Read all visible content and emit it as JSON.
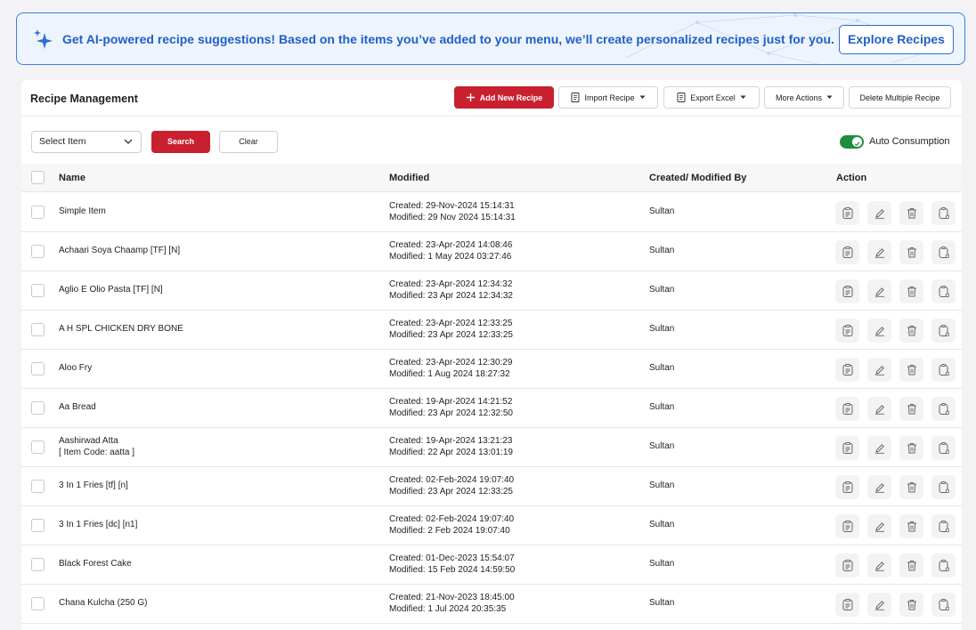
{
  "banner": {
    "text": "Get AI-powered recipe suggestions! Based on the items you’ve added to your menu, we’ll create personalized recipes just for you.",
    "button": "Explore Recipes"
  },
  "header": {
    "title": "Recipe Management",
    "add": "Add New Recipe",
    "import": "Import Recipe",
    "export": "Export Excel",
    "more": "More Actions",
    "delete_multiple": "Delete Multiple Recipe"
  },
  "filters": {
    "select_value": "Select Item",
    "search": "Search",
    "clear": "Clear",
    "auto_consumption": "Auto Consumption"
  },
  "table": {
    "columns": {
      "name": "Name",
      "modified": "Modified",
      "by": "Created/ Modified By",
      "action": "Action"
    },
    "rows": [
      {
        "name": "Simple Item",
        "sub": "",
        "created": "Created: 29-Nov-2024 15:14:31",
        "modified": "Modified: 29 Nov 2024 15:14:31",
        "by": "Sultan"
      },
      {
        "name": "Achaari Soya Chaamp [TF] [N]",
        "sub": "",
        "created": "Created: 23-Apr-2024 14:08:46",
        "modified": "Modified: 1 May 2024 03:27:46",
        "by": "Sultan"
      },
      {
        "name": "Aglio E Olio Pasta [TF] [N]",
        "sub": "",
        "created": "Created: 23-Apr-2024 12:34:32",
        "modified": "Modified: 23 Apr 2024 12:34:32",
        "by": "Sultan"
      },
      {
        "name": "A H SPL CHICKEN DRY BONE",
        "sub": "",
        "created": "Created: 23-Apr-2024 12:33:25",
        "modified": "Modified: 23 Apr 2024 12:33:25",
        "by": "Sultan"
      },
      {
        "name": "Aloo Fry",
        "sub": "",
        "created": "Created: 23-Apr-2024 12:30:29",
        "modified": "Modified: 1 Aug 2024 18:27:32",
        "by": "Sultan"
      },
      {
        "name": "Aa Bread",
        "sub": "",
        "created": "Created: 19-Apr-2024 14:21:52",
        "modified": "Modified: 23 Apr 2024 12:32:50",
        "by": "Sultan"
      },
      {
        "name": "Aashirwad Atta",
        "sub": "[ Item Code: aatta ]",
        "created": "Created: 19-Apr-2024 13:21:23",
        "modified": "Modified: 22 Apr 2024 13:01:19",
        "by": "Sultan"
      },
      {
        "name": "3 In 1 Fries [tf] [n]",
        "sub": "",
        "created": "Created: 02-Feb-2024 19:07:40",
        "modified": "Modified: 23 Apr 2024 12:33:25",
        "by": "Sultan"
      },
      {
        "name": "3 In 1 Fries [dc] [n1]",
        "sub": "",
        "created": "Created: 02-Feb-2024 19:07:40",
        "modified": "Modified: 2 Feb 2024 19:07:40",
        "by": "Sultan"
      },
      {
        "name": "Black Forest Cake",
        "sub": "",
        "created": "Created: 01-Dec-2023 15:54:07",
        "modified": "Modified: 15 Feb 2024 14:59:50",
        "by": "Sultan"
      },
      {
        "name": "Chana Kulcha (250 G)",
        "sub": "",
        "created": "Created: 21-Nov-2023 18:45:00",
        "modified": "Modified: 1 Jul 2024 20:35:35",
        "by": "Sultan"
      }
    ]
  },
  "colors": {
    "accent": "#c8202f",
    "banner_blue": "#2060c8",
    "toggle_on": "#1e8e3e"
  }
}
